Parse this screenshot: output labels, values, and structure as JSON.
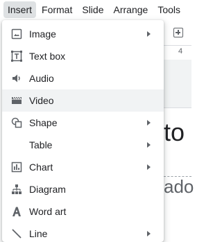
{
  "menubar": {
    "items": [
      {
        "label": "Insert"
      },
      {
        "label": "Format"
      },
      {
        "label": "Slide"
      },
      {
        "label": "Arrange"
      },
      {
        "label": "Tools"
      }
    ],
    "active": "Insert"
  },
  "background": {
    "ruler_number": "4",
    "slide_text_1": "to",
    "slide_text_2": "ado"
  },
  "insert_menu": {
    "items": [
      {
        "label": "Image",
        "icon": "image-icon",
        "submenu": true
      },
      {
        "label": "Text box",
        "icon": "text-box-icon",
        "submenu": false
      },
      {
        "label": "Audio",
        "icon": "audio-icon",
        "submenu": false
      },
      {
        "label": "Video",
        "icon": "video-icon",
        "submenu": false,
        "highlighted": true
      },
      {
        "label": "Shape",
        "icon": "shape-icon",
        "submenu": true
      },
      {
        "label": "Table",
        "icon": "",
        "submenu": true
      },
      {
        "label": "Chart",
        "icon": "chart-icon",
        "submenu": true
      },
      {
        "label": "Diagram",
        "icon": "diagram-icon",
        "submenu": false
      },
      {
        "label": "Word art",
        "icon": "word-art-icon",
        "submenu": false
      },
      {
        "label": "Line",
        "icon": "line-icon",
        "submenu": true
      }
    ]
  },
  "colors": {
    "active_menu_bg": "#dee1e3",
    "hover_row_bg": "#f1f3f4",
    "icon_color": "#5f6368"
  }
}
